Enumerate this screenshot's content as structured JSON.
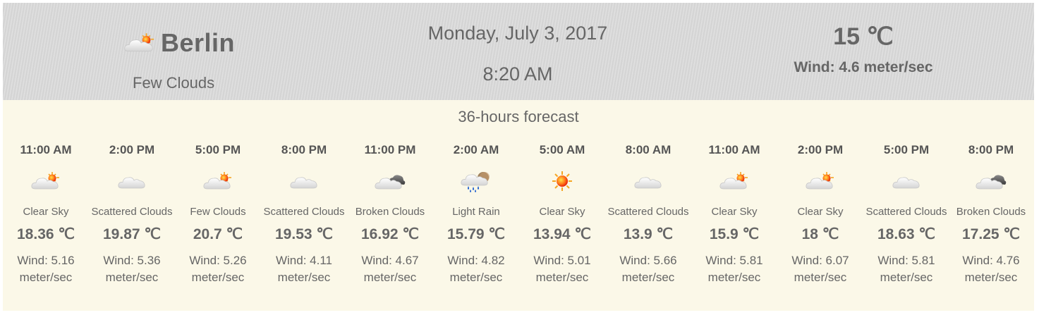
{
  "current": {
    "city": "Berlin",
    "condition": "Few Clouds",
    "icon": "few-clouds-icon",
    "date": "Monday, July 3, 2017",
    "time": "8:20 AM",
    "temperature": "15 ℃",
    "wind": "Wind: 4.6 meter/sec"
  },
  "forecast": {
    "title": "36-hours forecast",
    "items": [
      {
        "time": "11:00 AM",
        "condition": "Clear Sky",
        "temp": "18.36 ℃",
        "wind1": "Wind: 5.16",
        "wind2": "meter/sec",
        "icon": "few-clouds-icon"
      },
      {
        "time": "2:00 PM",
        "condition": "Scattered Clouds",
        "temp": "19.87 ℃",
        "wind1": "Wind: 5.36",
        "wind2": "meter/sec",
        "icon": "cloud-icon"
      },
      {
        "time": "5:00 PM",
        "condition": "Few Clouds",
        "temp": "20.7 ℃",
        "wind1": "Wind: 5.26",
        "wind2": "meter/sec",
        "icon": "few-clouds-icon"
      },
      {
        "time": "8:00 PM",
        "condition": "Scattered Clouds",
        "temp": "19.53 ℃",
        "wind1": "Wind: 4.11",
        "wind2": "meter/sec",
        "icon": "cloud-icon"
      },
      {
        "time": "11:00 PM",
        "condition": "Broken Clouds",
        "temp": "16.92 ℃",
        "wind1": "Wind: 4.67",
        "wind2": "meter/sec",
        "icon": "broken-clouds-icon"
      },
      {
        "time": "2:00 AM",
        "condition": "Light Rain",
        "temp": "15.79 ℃",
        "wind1": "Wind: 4.82",
        "wind2": "meter/sec",
        "icon": "rain-icon"
      },
      {
        "time": "5:00 AM",
        "condition": "Clear Sky",
        "temp": "13.94 ℃",
        "wind1": "Wind: 5.01",
        "wind2": "meter/sec",
        "icon": "sun-icon"
      },
      {
        "time": "8:00 AM",
        "condition": "Scattered Clouds",
        "temp": "13.9 ℃",
        "wind1": "Wind: 5.66",
        "wind2": "meter/sec",
        "icon": "cloud-icon"
      },
      {
        "time": "11:00 AM",
        "condition": "Clear Sky",
        "temp": "15.9 ℃",
        "wind1": "Wind: 5.81",
        "wind2": "meter/sec",
        "icon": "few-clouds-icon"
      },
      {
        "time": "2:00 PM",
        "condition": "Clear Sky",
        "temp": "18 ℃",
        "wind1": "Wind: 6.07",
        "wind2": "meter/sec",
        "icon": "few-clouds-icon"
      },
      {
        "time": "5:00 PM",
        "condition": "Scattered Clouds",
        "temp": "18.63 ℃",
        "wind1": "Wind: 5.81",
        "wind2": "meter/sec",
        "icon": "cloud-icon"
      },
      {
        "time": "8:00 PM",
        "condition": "Broken Clouds",
        "temp": "17.25 ℃",
        "wind1": "Wind: 4.76",
        "wind2": "meter/sec",
        "icon": "broken-clouds-icon"
      }
    ]
  },
  "colors": {
    "header_bg": "#d9d9d9",
    "forecast_bg": "#fbf8e8",
    "text": "#666666",
    "sun": "#f03a10"
  }
}
